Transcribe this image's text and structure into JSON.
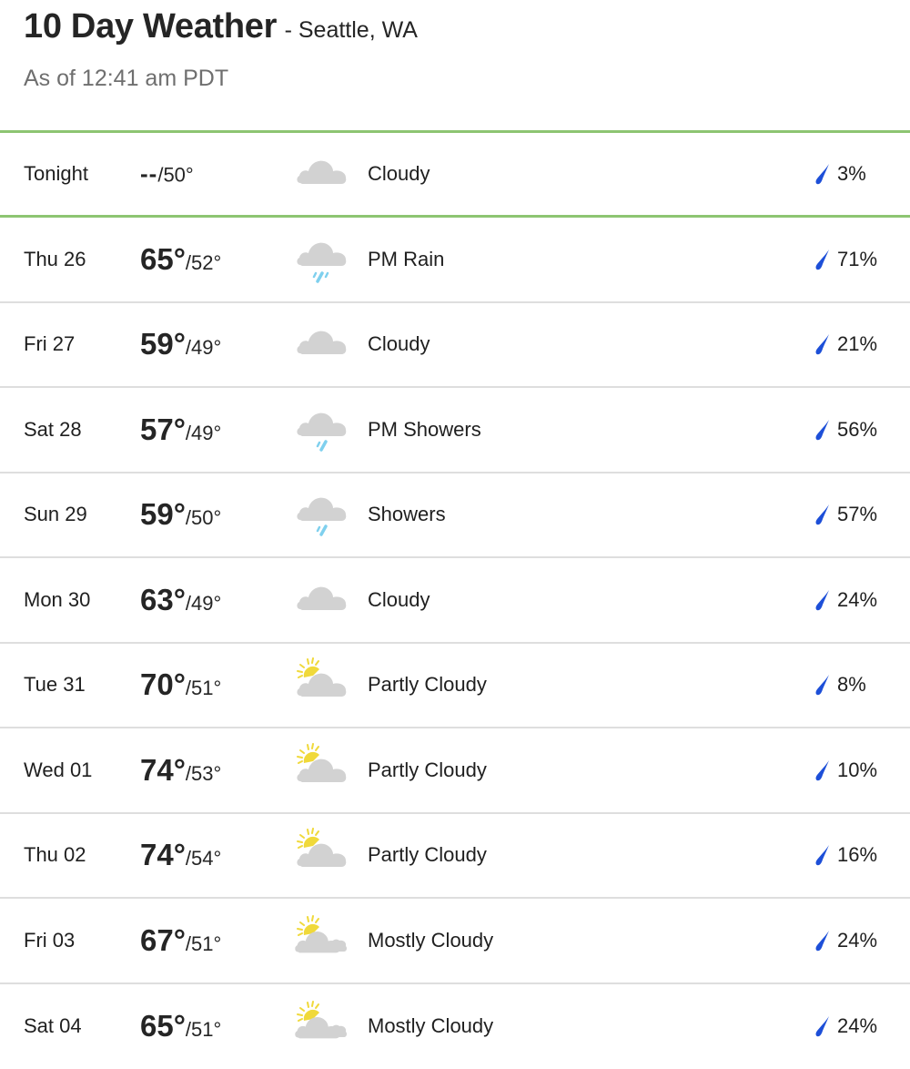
{
  "header": {
    "title": "10 Day Weather",
    "location": "- Seattle, WA",
    "as_of": "As of 12:41 am PDT"
  },
  "colors": {
    "current_row_border": "#8dc572",
    "row_divider": "#dedede",
    "precip_drop": "#1d4fd8",
    "cloud": "#d2d2d2",
    "sun": "#f0d93a",
    "rain": "#7fd0ee"
  },
  "forecast": [
    {
      "day": "Tonight",
      "high": "--",
      "low": "/50°",
      "icon": "cloudy-icon",
      "condition": "Cloudy",
      "precip": "3%",
      "current": true
    },
    {
      "day": "Thu 26",
      "high": "65°",
      "low": "/52°",
      "icon": "rain-icon",
      "condition": "PM Rain",
      "precip": "71%"
    },
    {
      "day": "Fri 27",
      "high": "59°",
      "low": "/49°",
      "icon": "cloudy-icon",
      "condition": "Cloudy",
      "precip": "21%"
    },
    {
      "day": "Sat 28",
      "high": "57°",
      "low": "/49°",
      "icon": "showers-icon",
      "condition": "PM Showers",
      "precip": "56%"
    },
    {
      "day": "Sun 29",
      "high": "59°",
      "low": "/50°",
      "icon": "showers-icon",
      "condition": "Showers",
      "precip": "57%"
    },
    {
      "day": "Mon 30",
      "high": "63°",
      "low": "/49°",
      "icon": "cloudy-icon",
      "condition": "Cloudy",
      "precip": "24%"
    },
    {
      "day": "Tue 31",
      "high": "70°",
      "low": "/51°",
      "icon": "partly-cloudy-icon",
      "condition": "Partly Cloudy",
      "precip": "8%"
    },
    {
      "day": "Wed 01",
      "high": "74°",
      "low": "/53°",
      "icon": "partly-cloudy-icon",
      "condition": "Partly Cloudy",
      "precip": "10%"
    },
    {
      "day": "Thu 02",
      "high": "74°",
      "low": "/54°",
      "icon": "partly-cloudy-icon",
      "condition": "Partly Cloudy",
      "precip": "16%"
    },
    {
      "day": "Fri 03",
      "high": "67°",
      "low": "/51°",
      "icon": "mostly-cloudy-icon",
      "condition": "Mostly Cloudy",
      "precip": "24%"
    },
    {
      "day": "Sat 04",
      "high": "65°",
      "low": "/51°",
      "icon": "mostly-cloudy-icon",
      "condition": "Mostly Cloudy",
      "precip": "24%"
    }
  ]
}
